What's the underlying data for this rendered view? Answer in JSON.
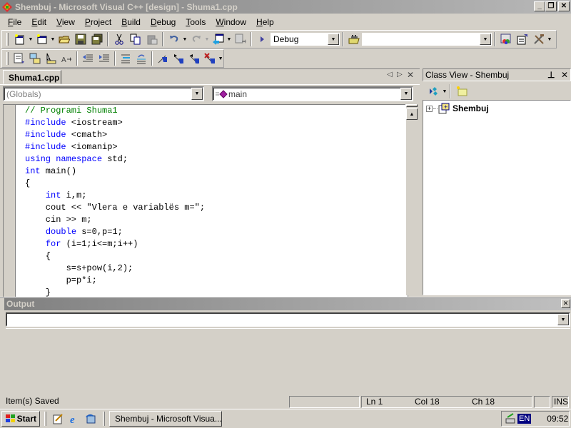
{
  "window": {
    "title": "Shembuj - Microsoft Visual C++ [design] - Shuma1.cpp",
    "minimize": "_",
    "restore": "❐",
    "close": "✕"
  },
  "menu": [
    "File",
    "Edit",
    "View",
    "Project",
    "Build",
    "Debug",
    "Tools",
    "Window",
    "Help"
  ],
  "toolbar": {
    "config_value": "Debug",
    "find_value": "",
    "icons_row1": [
      "new-file-icon",
      "new-workspace-icon",
      "open-folder-icon",
      "save-icon",
      "save-all-icon",
      "cut-icon",
      "copy-icon",
      "paste-icon",
      "undo-icon",
      "redo-icon",
      "workspace-icon",
      "output-window-icon",
      "run-arrow-icon",
      "find-in-files-icon",
      "class-wizard-icon",
      "wizard-bar-icon",
      "build-tools-icon"
    ],
    "icons_row2": [
      "compile-icon",
      "build-icon",
      "select-icon",
      "format-icon",
      "indent-left-icon",
      "indent-right-icon",
      "align-icon",
      "undo-format-icon",
      "bookmark-icon",
      "next-bookmark-icon",
      "prev-bookmark-icon",
      "clear-bookmark-icon"
    ]
  },
  "editor": {
    "tab_label": "Shuma1.cpp",
    "scope_combo": "(Globals)",
    "member_combo": "main",
    "code_lines": [
      [
        {
          "t": "// Programi Shuma1",
          "c": "cm"
        }
      ],
      [
        {
          "t": "#include",
          "c": "kw"
        },
        {
          "t": " <iostream>",
          "c": ""
        }
      ],
      [
        {
          "t": "#include",
          "c": "kw"
        },
        {
          "t": " <cmath>",
          "c": ""
        }
      ],
      [
        {
          "t": "#include",
          "c": "kw"
        },
        {
          "t": " <iomanip>",
          "c": ""
        }
      ],
      [
        {
          "t": "using",
          "c": "kw"
        },
        {
          "t": " ",
          "c": ""
        },
        {
          "t": "namespace",
          "c": "kw"
        },
        {
          "t": " std;",
          "c": ""
        }
      ],
      [
        {
          "t": "int",
          "c": "kw"
        },
        {
          "t": " main()",
          "c": ""
        }
      ],
      [
        {
          "t": "{",
          "c": ""
        }
      ],
      [
        {
          "t": "    ",
          "c": ""
        },
        {
          "t": "int",
          "c": "kw"
        },
        {
          "t": " i,m;",
          "c": ""
        }
      ],
      [
        {
          "t": "    cout << \"Vlera e variablës m=\";",
          "c": ""
        }
      ],
      [
        {
          "t": "    cin >> m;",
          "c": ""
        }
      ],
      [
        {
          "t": "    ",
          "c": ""
        },
        {
          "t": "double",
          "c": "kw"
        },
        {
          "t": " s=0,p=1;",
          "c": ""
        }
      ],
      [
        {
          "t": "    ",
          "c": ""
        },
        {
          "t": "for",
          "c": "kw"
        },
        {
          "t": " (i=1;i<=m;i++)",
          "c": ""
        }
      ],
      [
        {
          "t": "    {",
          "c": ""
        }
      ],
      [
        {
          "t": "        s=s+pow(i,2);",
          "c": ""
        }
      ],
      [
        {
          "t": "        p=p*i;",
          "c": ""
        }
      ],
      [
        {
          "t": "    }",
          "c": ""
        }
      ]
    ]
  },
  "class_view": {
    "title": "Class View - Shembuj",
    "pin": "⊥",
    "close": "✕",
    "root_item": "Shembuj",
    "expander": "+"
  },
  "output": {
    "title": "Output",
    "close": "✕",
    "combo_value": ""
  },
  "status": {
    "message": "Item(s) Saved",
    "ln": "Ln 1",
    "col": "Col 18",
    "ch": "Ch 18",
    "ins": "INS"
  },
  "taskbar": {
    "start": "Start",
    "task": "Shembuj - Microsoft Visua...",
    "lang": "EN",
    "clock": "09:52"
  }
}
